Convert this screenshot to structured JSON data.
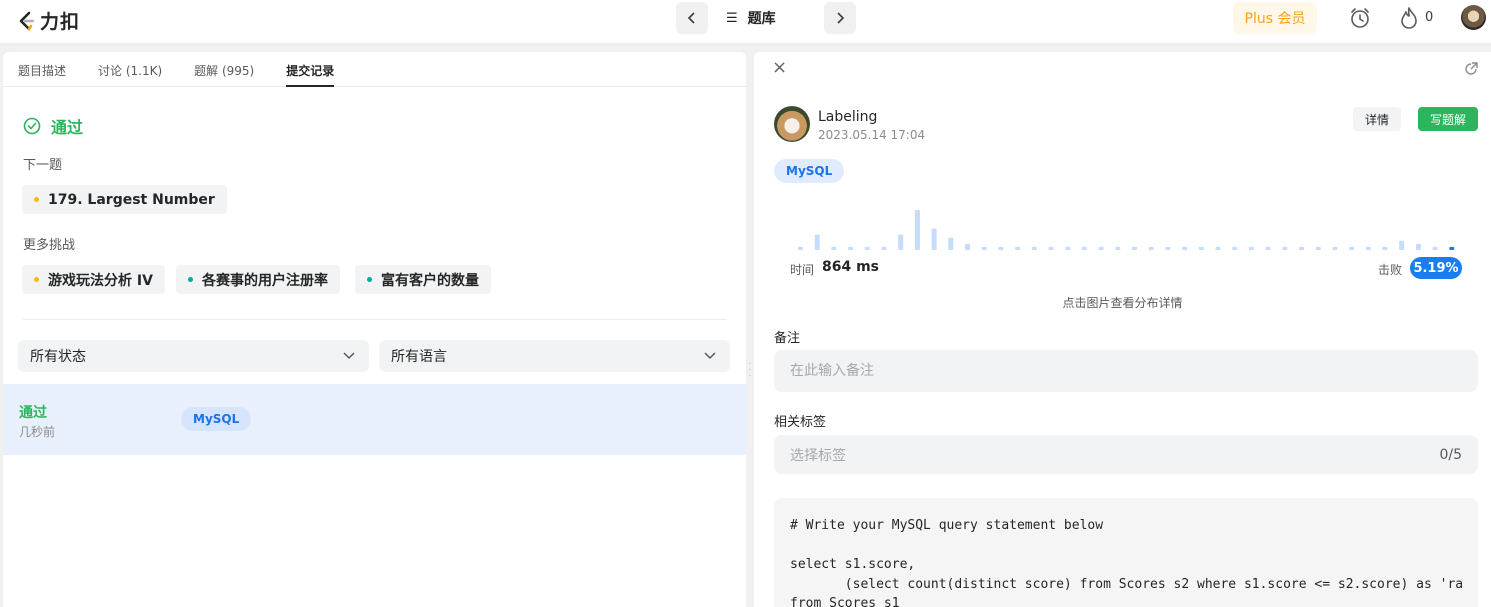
{
  "topbar": {
    "logo_text": "力扣",
    "center_title": "题库",
    "plus_label": "Plus 会员",
    "streak_count": "0"
  },
  "left": {
    "tabs": [
      {
        "label": "题目描述"
      },
      {
        "label": "讨论 (1.1K)"
      },
      {
        "label": "题解 (995)"
      },
      {
        "label": "提交记录",
        "active": true
      }
    ],
    "status": "通过",
    "next_label": "下一题",
    "next_item": "179. Largest Number",
    "more_label": "更多挑战",
    "challenges": [
      {
        "label": "游戏玩法分析 IV",
        "color": "orange"
      },
      {
        "label": "各赛事的用户注册率",
        "color": "teal"
      },
      {
        "label": "富有客户的数量",
        "color": "teal"
      }
    ],
    "filter_status": "所有状态",
    "filter_lang": "所有语言",
    "submission": {
      "status": "通过",
      "time": "几秒前",
      "lang": "MySQL"
    }
  },
  "right": {
    "user_name": "Labeling",
    "date": "2023.05.14 17:04",
    "detail_label": "详情",
    "write_label": "写题解",
    "lang": "MySQL",
    "distribution": [
      1,
      5,
      1,
      1,
      1,
      1,
      5,
      13,
      7,
      4,
      2,
      1,
      1,
      1,
      1,
      1,
      1,
      1,
      1,
      1,
      1,
      1,
      1,
      1,
      1,
      1,
      1,
      1,
      1,
      1,
      1,
      1,
      1,
      1,
      1,
      1,
      3,
      2,
      1,
      1
    ],
    "highlight_index": 39,
    "runtime_label": "时间",
    "runtime_value": "864 ms",
    "beat_label": "击败",
    "beat_value": "5.19%",
    "hint": "点击图片查看分布详情",
    "note_label": "备注",
    "note_placeholder": "在此输入备注",
    "tags_label": "相关标签",
    "tags_placeholder": "选择标签",
    "tags_count": "0/5",
    "code": "# Write your MySQL query statement below\n\nselect s1.score,\n       (select count(distinct score) from Scores s2 where s1.score <= s2.score) as 'ra\nfrom Scores s1"
  },
  "colors": {
    "accent_green": "#2db55d",
    "accent_blue": "#1a7ef2",
    "accent_orange": "#ffa116"
  }
}
